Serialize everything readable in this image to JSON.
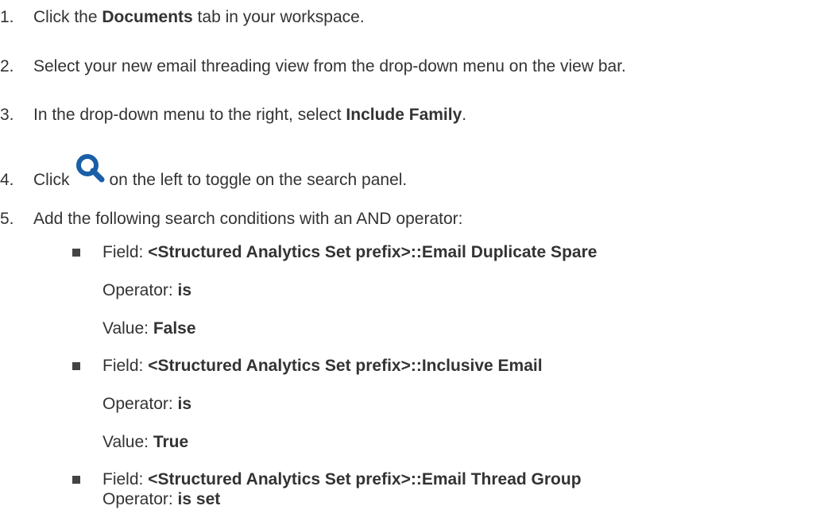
{
  "steps": [
    {
      "num": "1.",
      "pre": "Click the ",
      "bold": "Documents",
      "post": " tab in your workspace."
    },
    {
      "num": "2.",
      "text": "Select your new email threading view from the drop-down menu on the view bar."
    },
    {
      "num": "3.",
      "pre": "In the drop-down menu to the right, select ",
      "bold": "Include Family",
      "post": "."
    },
    {
      "num": "4.",
      "pre": "Click",
      "post": "on the left to toggle on the search panel.",
      "icon": "search-icon"
    },
    {
      "num": "5.",
      "text": "Add the following search conditions with an AND operator:"
    }
  ],
  "conditions": [
    {
      "field_label": "Field: ",
      "field_value": "<Structured Analytics Set prefix>::Email Duplicate Spare",
      "operator_label": "Operator: ",
      "operator_value": "is",
      "value_label": "Value: ",
      "value_value": "False"
    },
    {
      "field_label": "Field: ",
      "field_value": "<Structured Analytics Set prefix>::Inclusive Email",
      "operator_label": "Operator: ",
      "operator_value": "is",
      "value_label": "Value: ",
      "value_value": "True"
    },
    {
      "field_label": "Field: ",
      "field_value": "<Structured Analytics Set prefix>::Email Thread Group",
      "operator_label": "Operator: ",
      "operator_value": "is set"
    }
  ],
  "colors": {
    "text": "#333333",
    "icon": "#1a5fa8"
  }
}
